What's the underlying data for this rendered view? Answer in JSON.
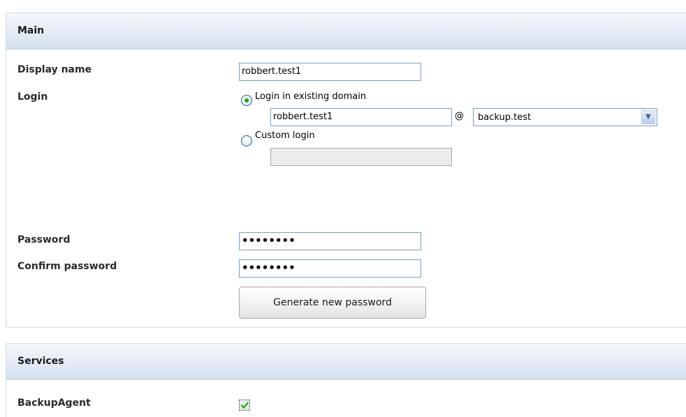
{
  "main": {
    "title": "Main",
    "display_name": {
      "label": "Display name",
      "value": "robbert.test1"
    },
    "login": {
      "label": "Login",
      "option_existing": {
        "label": "Login in existing domain",
        "selected": true
      },
      "login_value": "robbert.test1",
      "at": "@",
      "domain": "backup.test",
      "option_custom": {
        "label": "Custom login",
        "selected": false
      },
      "custom_value": ""
    },
    "password": {
      "label": "Password",
      "value": "••••••••"
    },
    "confirm_password": {
      "label": "Confirm password",
      "value": "••••••••"
    },
    "generate_button": "Generate new password"
  },
  "services": {
    "title": "Services",
    "backup_agent": {
      "label": "BackupAgent",
      "checked": true
    }
  },
  "colors": {
    "header_gradient_end": "#d4e1ef",
    "input_border": "#7f9db9",
    "radio_dot": "#1ea51e",
    "check": "#1ea51e"
  },
  "icons": {
    "dropdown": "chevron-down-icon",
    "check": "checkmark-icon"
  }
}
